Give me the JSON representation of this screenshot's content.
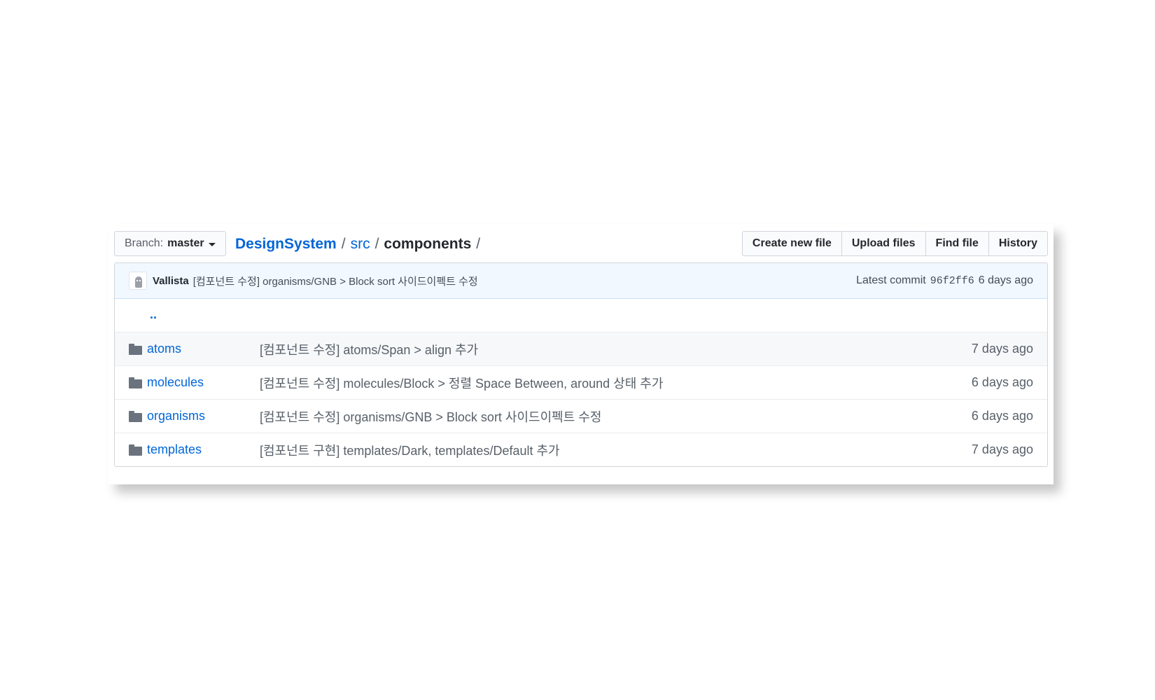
{
  "topbar": {
    "branch_prefix": "Branch:",
    "branch_name": "master",
    "breadcrumb": {
      "root": "DesignSystem",
      "sep1": "/",
      "mid": "src",
      "sep2": "/",
      "final": "components",
      "sep3": "/"
    },
    "buttons": [
      {
        "label": "Create new file"
      },
      {
        "label": "Upload files"
      },
      {
        "label": "Find file"
      },
      {
        "label": "History"
      }
    ]
  },
  "commit": {
    "author": "Vallista",
    "message": "[컴포넌트 수정] organisms/GNB > Block sort 사이드이펙트 수정",
    "latest_label": "Latest commit",
    "sha": "96f2ff6",
    "age": "6 days ago"
  },
  "up_dir": "..",
  "files": [
    {
      "name": "atoms",
      "message": "[컴포넌트 수정] atoms/Span > align 추가",
      "age": "7 days ago",
      "icon": "folder-icon"
    },
    {
      "name": "molecules",
      "message": "[컴포넌트 수정] molecules/Block > 정렬 Space Between, around 상태 추가",
      "age": "6 days ago",
      "icon": "folder-icon"
    },
    {
      "name": "organisms",
      "message": "[컴포넌트 수정] organisms/GNB > Block sort 사이드이펙트 수정",
      "age": "6 days ago",
      "icon": "folder-icon"
    },
    {
      "name": "templates",
      "message": "[컴포넌트 구현] templates/Dark, templates/Default 추가",
      "age": "7 days ago",
      "icon": "folder-icon"
    }
  ],
  "colors": {
    "link": "#0366d6",
    "commit_bg": "#f1f8ff",
    "folder": "#6a737d"
  }
}
